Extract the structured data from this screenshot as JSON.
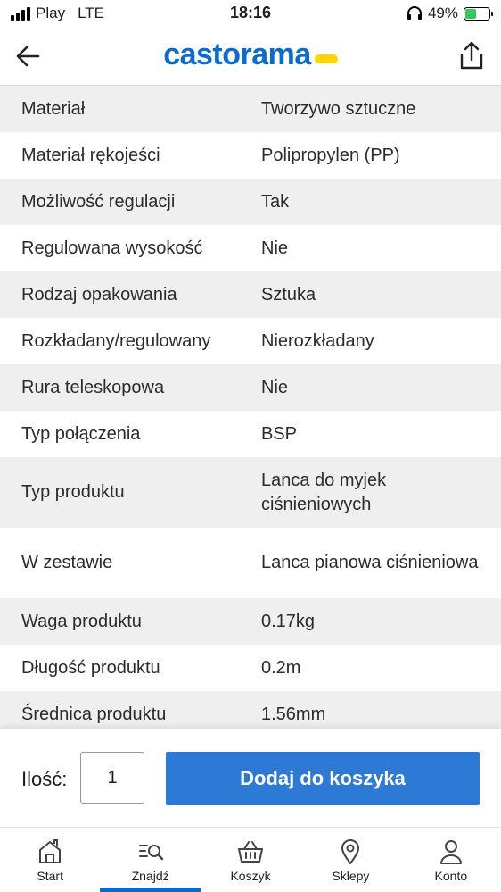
{
  "status_bar": {
    "carrier": "Play",
    "network": "LTE",
    "time": "18:16",
    "battery": "49%",
    "battery_level": 0.49
  },
  "header": {
    "logo": "castorama",
    "logo_color": "#0b6cd0",
    "logo_accent_color": "#ffd500",
    "back_icon": "arrow-left-icon",
    "share_icon": "share-icon"
  },
  "specs": [
    {
      "label": "Materiał",
      "value": "Tworzywo sztuczne"
    },
    {
      "label": "Materiał rękojeści",
      "value": "Polipropylen (PP)"
    },
    {
      "label": "Możliwość regulacji",
      "value": "Tak"
    },
    {
      "label": "Regulowana wysokość",
      "value": "Nie"
    },
    {
      "label": "Rodzaj opakowania",
      "value": "Sztuka"
    },
    {
      "label": "Rozkładany/regulowany",
      "value": "Nierozkładany"
    },
    {
      "label": "Rura teleskopowa",
      "value": "Nie"
    },
    {
      "label": "Typ połączenia",
      "value": "BSP"
    },
    {
      "label": "Typ produktu",
      "value": "Lanca do myjek ciśnieniowych"
    },
    {
      "label": "W zestawie",
      "value": "Lanca pianowa ciśnieniowa"
    },
    {
      "label": "Waga produktu",
      "value": "0.17kg"
    },
    {
      "label": "Długość produktu",
      "value": "0.2m"
    },
    {
      "label": "Średnica produktu",
      "value": "1.56mm"
    }
  ],
  "cart": {
    "qty_label": "Ilość:",
    "qty_value": "1",
    "add_button": "Dodaj do koszyka",
    "button_color": "#2d7ad6"
  },
  "nav": {
    "items": [
      {
        "label": "Start",
        "icon": "home-icon"
      },
      {
        "label": "Znajdź",
        "icon": "search-list-icon",
        "active": true
      },
      {
        "label": "Koszyk",
        "icon": "basket-icon"
      },
      {
        "label": "Sklepy",
        "icon": "location-pin-icon"
      },
      {
        "label": "Konto",
        "icon": "user-icon"
      }
    ]
  }
}
